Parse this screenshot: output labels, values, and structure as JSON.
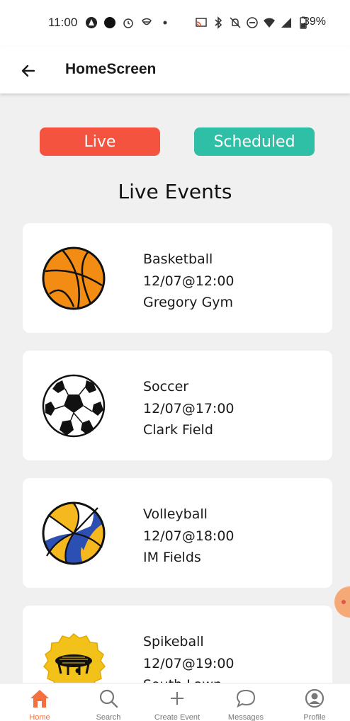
{
  "status_bar": {
    "time": "11:00",
    "battery": "39%"
  },
  "app_bar": {
    "title": "HomeScreen",
    "back_icon": "arrow-left-icon"
  },
  "toggles": {
    "live_label": "Live",
    "scheduled_label": "Scheduled"
  },
  "section_title": "Live Events",
  "events": [
    {
      "sport": "Basketball",
      "datetime": "12/07@12:00",
      "location": "Gregory Gym",
      "icon": "basketball-icon"
    },
    {
      "sport": "Soccer",
      "datetime": "12/07@17:00",
      "location": "Clark Field",
      "icon": "soccer-ball-icon"
    },
    {
      "sport": "Volleyball",
      "datetime": "12/07@18:00",
      "location": "IM Fields",
      "icon": "volleyball-icon"
    },
    {
      "sport": "Spikeball",
      "datetime": "12/07@19:00",
      "location": "South Lawn",
      "icon": "spikeball-icon"
    }
  ],
  "bottom_nav": [
    {
      "label": "Home",
      "icon": "home-icon",
      "active": true
    },
    {
      "label": "Search",
      "icon": "search-icon",
      "active": false
    },
    {
      "label": "Create Event",
      "icon": "plus-icon",
      "active": false
    },
    {
      "label": "Messages",
      "icon": "chat-bubble-icon",
      "active": false
    },
    {
      "label": "Profile",
      "icon": "profile-icon",
      "active": false
    }
  ],
  "colors": {
    "live": "#f4533f",
    "scheduled": "#2fbea6",
    "nav_active": "#f4713f",
    "background": "#f0f0f0"
  }
}
